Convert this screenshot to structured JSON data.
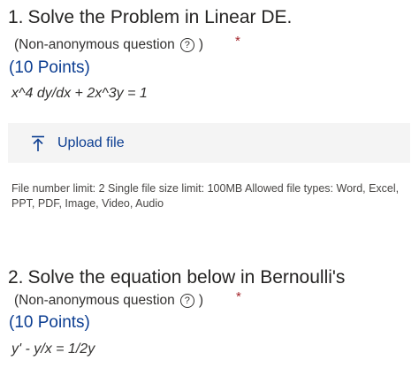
{
  "q1": {
    "number": "1.",
    "title": "Solve the Problem in Linear DE.",
    "sub_open": "(Non-anonymous question",
    "help_glyph": "?",
    "sub_close": ")",
    "required": "*",
    "points": "(10 Points)",
    "equation": "x^4 dy/dx + 2x^3y = 1"
  },
  "upload": {
    "label": "Upload file",
    "icon": "upload-icon"
  },
  "limits": "File number limit: 2   Single file size limit: 100MB   Allowed file types: Word, Excel, PPT, PDF, Image, Video, Audio",
  "q2": {
    "number": "2.",
    "title": "Solve the equation below in Bernoulli's",
    "sub_open": "(Non-anonymous question",
    "help_glyph": "?",
    "sub_close": ")",
    "required": "*",
    "points": "(10 Points)",
    "equation": "y' - y/x = 1/2y"
  },
  "colors": {
    "accent": "#0b3d91",
    "required": "#a4262c",
    "upload_bg": "#f4f4f4"
  }
}
